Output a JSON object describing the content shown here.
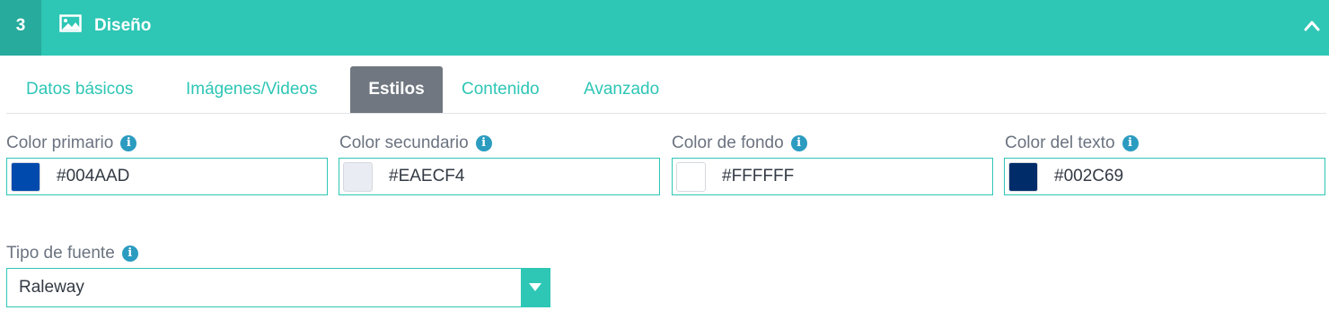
{
  "header": {
    "step": "3",
    "title": "Diseño",
    "icon": "image-icon",
    "collapse_icon": "chevron-up-icon",
    "bg_color": "#2ec6b5"
  },
  "tabs": [
    {
      "label": "Datos básicos",
      "active": false
    },
    {
      "label": "Imágenes/Videos",
      "active": false
    },
    {
      "label": "Estilos",
      "active": true
    },
    {
      "label": "Contenido",
      "active": false
    },
    {
      "label": "Avanzado",
      "active": false
    }
  ],
  "colors": [
    {
      "label": "Color primario",
      "value": "#004AAD"
    },
    {
      "label": "Color secundario",
      "value": "#EAECF4"
    },
    {
      "label": "Color de fondo",
      "value": "#FFFFFF"
    },
    {
      "label": "Color del texto",
      "value": "#002C69"
    }
  ],
  "font": {
    "label": "Tipo de fuente",
    "value": "Raleway"
  },
  "info_glyph": "i"
}
